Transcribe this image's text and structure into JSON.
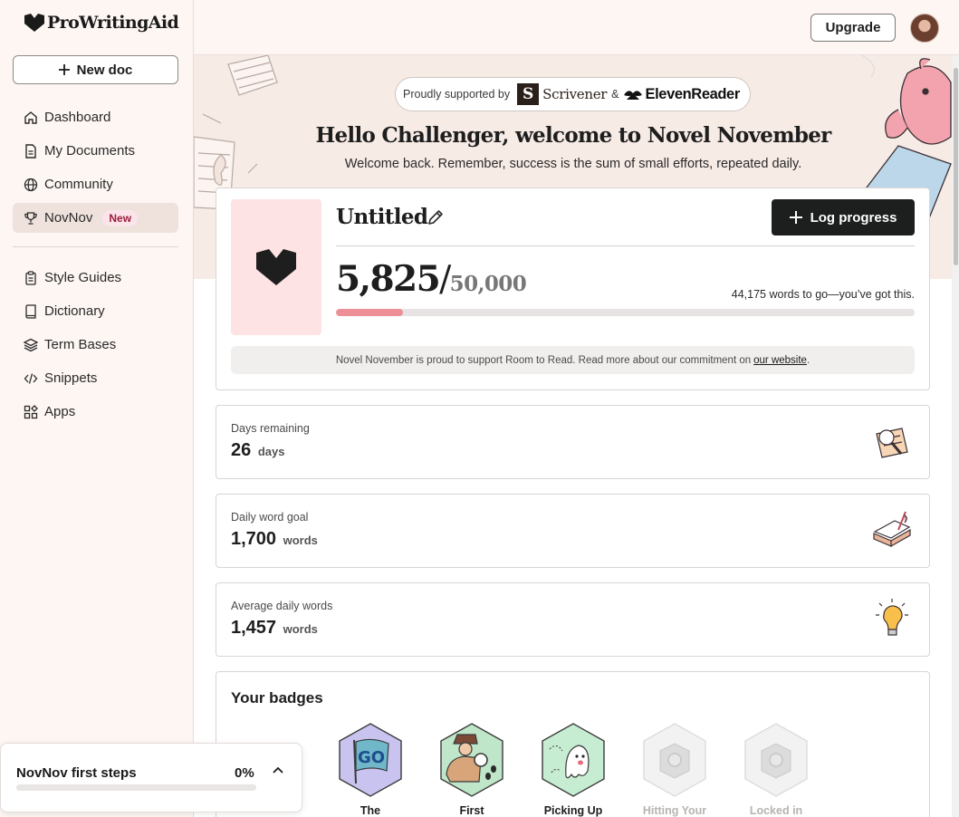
{
  "brand": {
    "name": "ProWritingAid"
  },
  "sidebar": {
    "new_doc_label": "New doc",
    "items": [
      {
        "label": "Dashboard",
        "icon": "home-icon"
      },
      {
        "label": "My Documents",
        "icon": "document-icon"
      },
      {
        "label": "Community",
        "icon": "globe-icon"
      },
      {
        "label": "NovNov",
        "icon": "trophy-icon",
        "badge": "New",
        "active": true
      }
    ],
    "tools": [
      {
        "label": "Style Guides",
        "icon": "clipboard-icon"
      },
      {
        "label": "Dictionary",
        "icon": "book-icon"
      },
      {
        "label": "Term Bases",
        "icon": "layers-icon"
      },
      {
        "label": "Snippets",
        "icon": "code-icon"
      },
      {
        "label": "Apps",
        "icon": "apps-icon"
      }
    ]
  },
  "first_steps": {
    "title": "NovNov first steps",
    "percent_label": "0%",
    "progress": 0
  },
  "header": {
    "upgrade_label": "Upgrade"
  },
  "hero": {
    "supported_by": "Proudly supported by",
    "scrivener": "Scrivener",
    "ampersand": "&",
    "elevenreader": "ElevenReader",
    "title": "Hello Challenger, welcome to Novel November",
    "subtitle": "Welcome back. Remember, success is the sum of small efforts, repeated daily."
  },
  "project": {
    "title": "Untitled",
    "log_progress_label": "Log progress",
    "word_count": "5,825",
    "slash": "/",
    "word_goal": "50,000",
    "remaining_text": "44,175 words to go—you’ve got this.",
    "progress_fraction": 0.1165,
    "room_text": "Novel November is proud to support Room to Read. Read more about our commitment on",
    "room_link": "our website",
    "room_period": "."
  },
  "stats": [
    {
      "label": "Days remaining",
      "value": "26",
      "unit": "days",
      "icon": "magnifier-notes-icon"
    },
    {
      "label": "Daily word goal",
      "value": "1,700",
      "unit": "words",
      "icon": "open-book-quill-icon"
    },
    {
      "label": "Average daily words",
      "value": "1,457",
      "unit": "words",
      "icon": "lightbulb-icon"
    }
  ],
  "badges": {
    "title": "Your badges",
    "items": [
      {
        "name": "The",
        "icon": "go-flag-badge-icon",
        "locked": false,
        "color": "#c9c3ef"
      },
      {
        "name": "First",
        "icon": "detective-badge-icon",
        "locked": false,
        "color": "#bfe6c8"
      },
      {
        "name": "Picking Up",
        "icon": "ghost-badge-icon",
        "locked": false,
        "color": "#c6ecd2"
      },
      {
        "name": "Hitting Your",
        "icon": "locked-badge-icon",
        "locked": true,
        "color": "#ececec"
      },
      {
        "name": "Locked in",
        "icon": "locked-badge-icon",
        "locked": true,
        "color": "#ececec"
      }
    ]
  },
  "colors": {
    "accent_pink": "#ec8f97",
    "dark_button": "#1c1f1e",
    "sidebar_bg": "#fdf6f3",
    "active_nav": "#efe2dd"
  }
}
